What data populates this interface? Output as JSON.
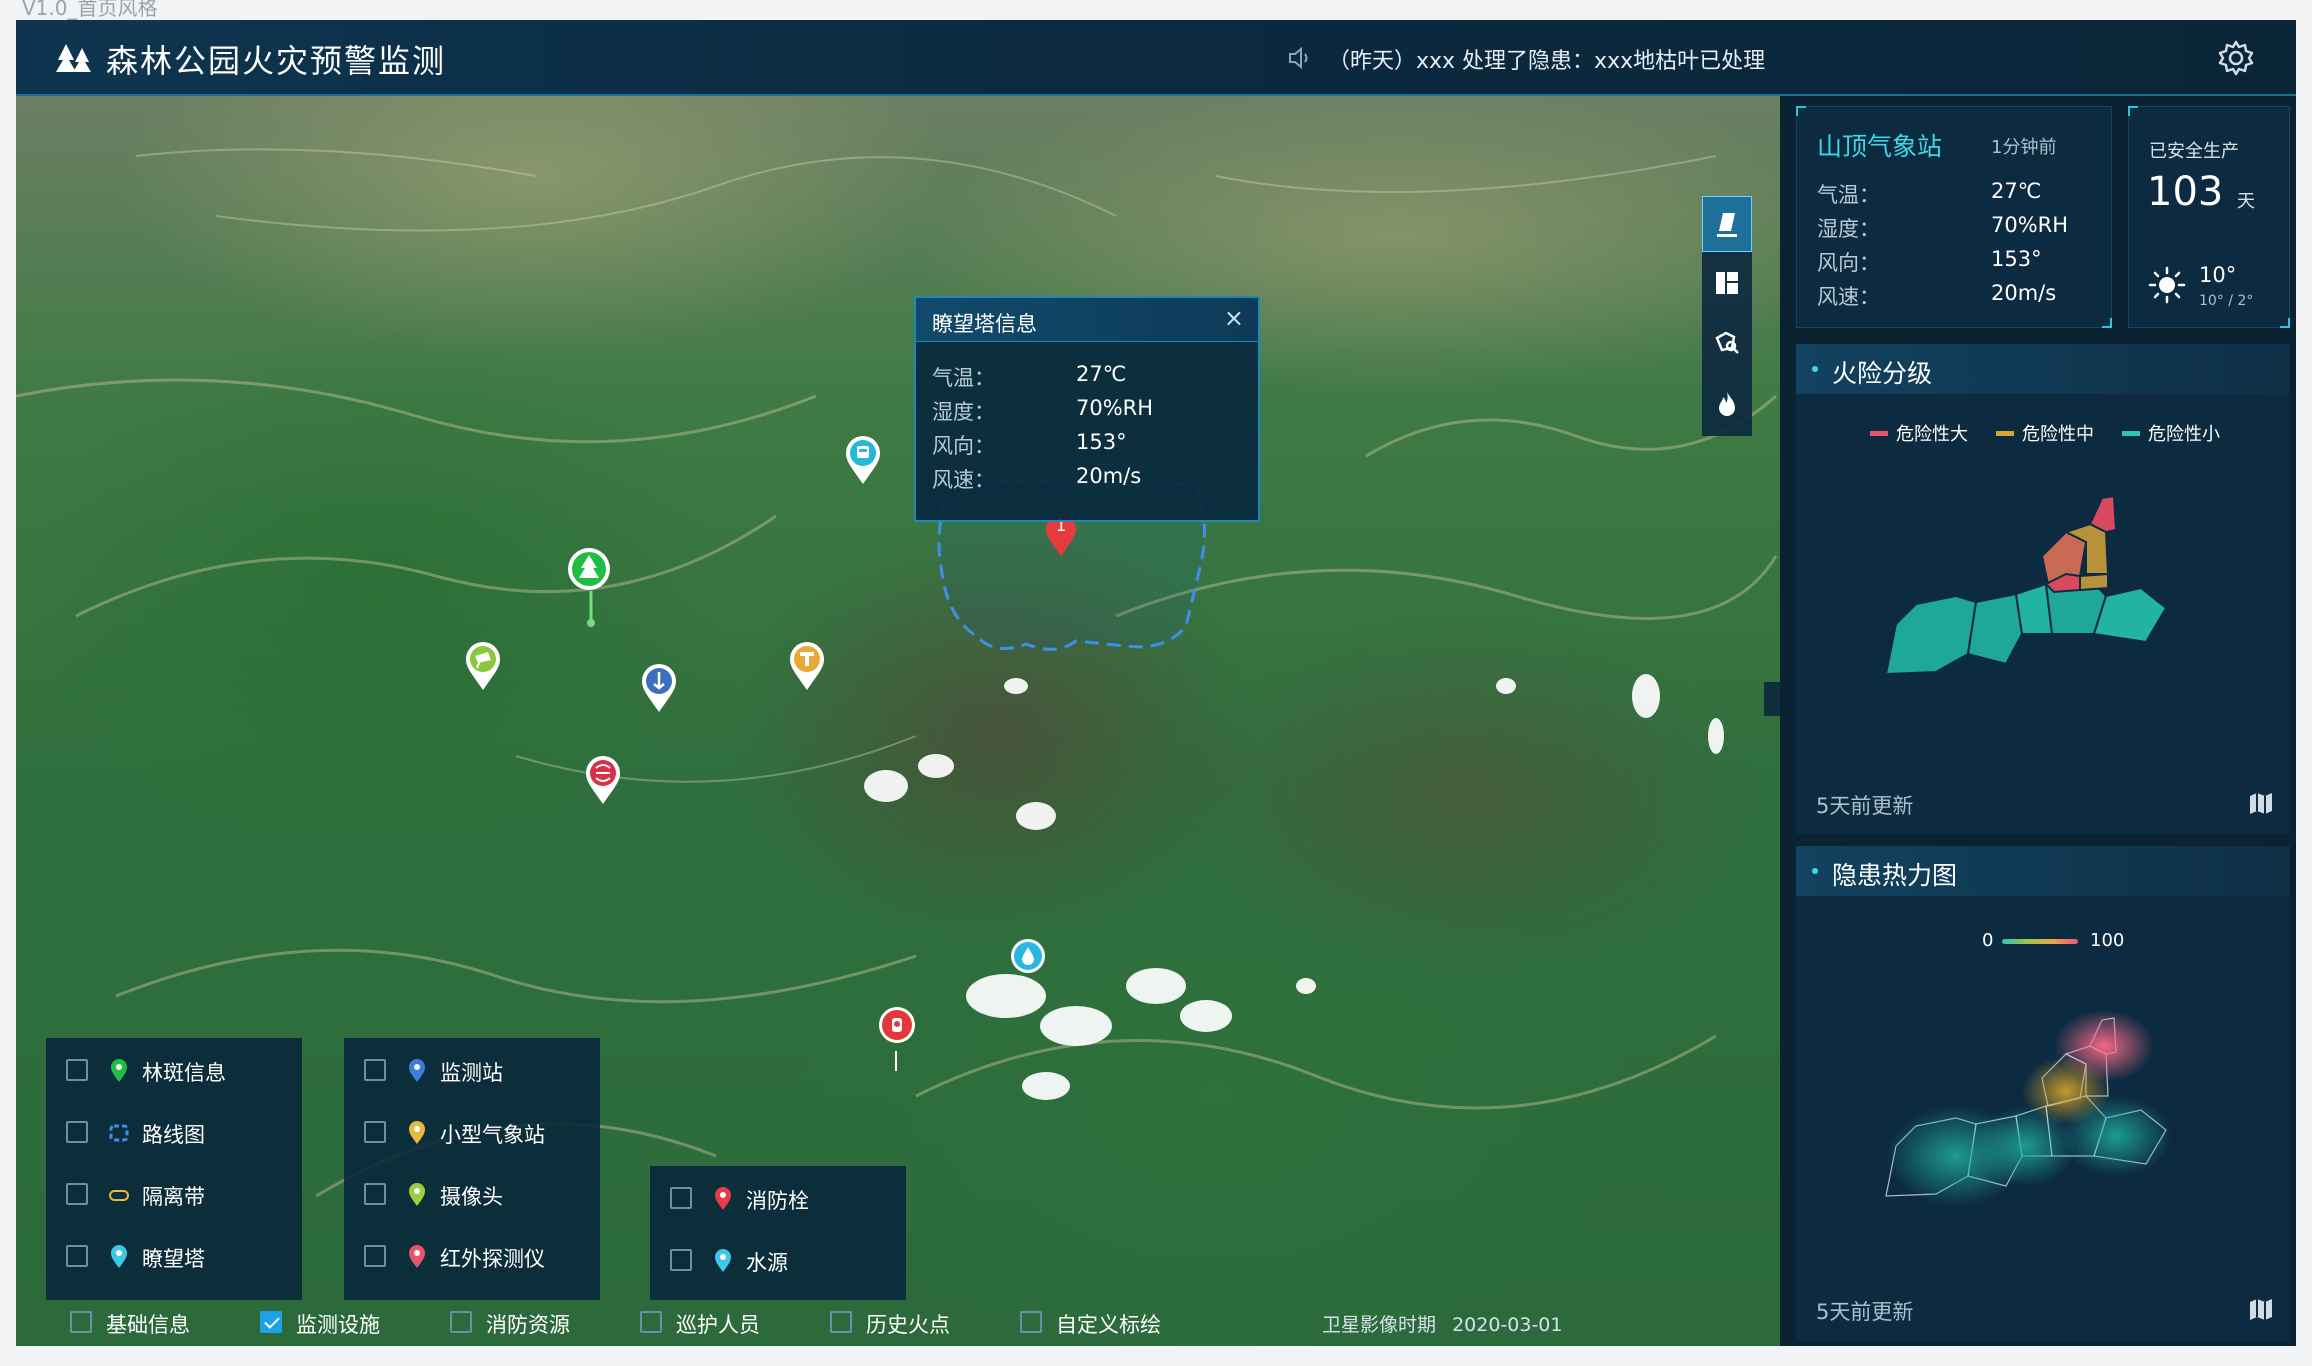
{
  "version": "V1.0_首页风格",
  "header": {
    "title": "森林公园火灾预警监测",
    "notice": "（昨天）xxx 处理了隐患：xxx地枯叶已处理"
  },
  "popup": {
    "title": "瞭望塔信息",
    "close": "×",
    "rows": [
      {
        "key": "气温：",
        "value": "27℃"
      },
      {
        "key": "湿度：",
        "value": "70%RH"
      },
      {
        "key": "风向：",
        "value": "153°"
      },
      {
        "key": "风速：",
        "value": "20m/s"
      }
    ]
  },
  "map": {
    "hazard_marker_number": "1",
    "imagery_date_label": "卫星影像时期",
    "imagery_date": "2020-03-01"
  },
  "layers": {
    "col1": [
      {
        "label": "林斑信息",
        "icon": "forest-pin-icon",
        "checked": false
      },
      {
        "label": "路线图",
        "icon": "route-icon",
        "checked": false
      },
      {
        "label": "隔离带",
        "icon": "isolation-belt-icon",
        "checked": false
      },
      {
        "label": "瞭望塔",
        "icon": "watchtower-pin-icon",
        "checked": false
      }
    ],
    "col2": [
      {
        "label": "监测站",
        "icon": "station-pin-icon",
        "checked": false
      },
      {
        "label": "小型气象站",
        "icon": "weather-pin-icon",
        "checked": false
      },
      {
        "label": "摄像头",
        "icon": "camera-pin-icon",
        "checked": false
      },
      {
        "label": "红外探测仪",
        "icon": "infrared-pin-icon",
        "checked": false
      }
    ],
    "col3": [
      {
        "label": "消防栓",
        "icon": "hydrant-pin-icon",
        "checked": false
      },
      {
        "label": "水源",
        "icon": "water-pin-icon",
        "checked": false
      }
    ]
  },
  "bottom_tabs": [
    {
      "label": "基础信息",
      "checked": false
    },
    {
      "label": "监测设施",
      "checked": true
    },
    {
      "label": "消防资源",
      "checked": false
    },
    {
      "label": "巡护人员",
      "checked": false
    },
    {
      "label": "历史火点",
      "checked": false
    },
    {
      "label": "自定义标绘",
      "checked": false
    }
  ],
  "weather_station": {
    "name": "山顶气象站",
    "updated": "1分钟前",
    "rows": [
      {
        "key": "气温：",
        "value": "27℃"
      },
      {
        "key": "湿度：",
        "value": "70%RH"
      },
      {
        "key": "风向：",
        "value": "153°"
      },
      {
        "key": "风速：",
        "value": "20m/s"
      }
    ]
  },
  "safety": {
    "label": "已安全生产",
    "days": "103",
    "unit": "天",
    "temp_now": "10°",
    "temp_range": "10° / 2°"
  },
  "fire_risk": {
    "title": "火险分级",
    "legend": [
      {
        "label": "危险性大",
        "color": "#e5546a"
      },
      {
        "label": "危险性中",
        "color": "#d9a52b"
      },
      {
        "label": "危险性小",
        "color": "#2ec4b6"
      }
    ],
    "updated": "5天前更新"
  },
  "heatmap": {
    "title": "隐患热力图",
    "min": "0",
    "max": "100",
    "updated": "5天前更新"
  },
  "colors": {
    "accent": "#3fd6e8",
    "panel_bg": "#0d2b40",
    "header_bg": "#0e3550"
  }
}
